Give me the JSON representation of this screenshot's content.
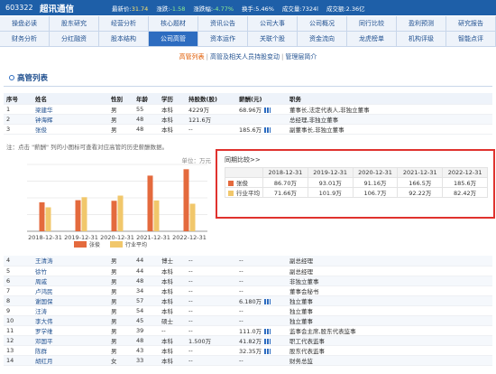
{
  "header": {
    "code": "603322",
    "name": "超讯通信",
    "quotes": [
      {
        "label": "最新价:",
        "value": "31.74",
        "cls": "up"
      },
      {
        "label": "涨跌:",
        "value": "-1.58",
        "cls": "dn"
      },
      {
        "label": "涨跌幅:",
        "value": "-4.77%",
        "cls": "dn"
      },
      {
        "label": "换手:",
        "value": "5.46%",
        "cls": ""
      },
      {
        "label": "成交量:",
        "value": "7324l",
        "cls": ""
      },
      {
        "label": "成交额:",
        "value": "2.36亿",
        "cls": ""
      }
    ]
  },
  "nav": {
    "row1": [
      "操盘必读",
      "股东研究",
      "经营分析",
      "核心题材",
      "资讯公告",
      "公司大事",
      "公司概况",
      "同行比较",
      "盈利预测",
      "研究报告"
    ],
    "row2": [
      "财务分析",
      "分红融资",
      "股本结构",
      "公司高管",
      "资本运作",
      "关联个股",
      "资金流向",
      "龙虎榜单",
      "机构评级",
      "智能点评"
    ],
    "active": "公司高管"
  },
  "sublinks": {
    "items": [
      "高管列表",
      "高管及相关人员持股变动",
      "管理层简介"
    ],
    "separator": "|"
  },
  "section_title": "高管列表",
  "table": {
    "headers": [
      "序号",
      "姓名",
      "性别",
      "年龄",
      "学历",
      "持股数(股)",
      "薪酬(元)",
      "职务"
    ],
    "top_rows": [
      [
        "1",
        "梁建华",
        "男",
        "55",
        "本科",
        "4229万",
        "68.96万",
        "董事长,法定代表人,非独立董事"
      ],
      [
        "2",
        "钟海辉",
        "男",
        "48",
        "本科",
        "121.6万",
        "",
        "总经理,非独立董事"
      ],
      [
        "3",
        "张俊",
        "男",
        "48",
        "本科",
        "--",
        "185.6万",
        "副董事长,非独立董事"
      ]
    ],
    "bottom_rows": [
      [
        "4",
        "王清涛",
        "男",
        "44",
        "博士",
        "--",
        "--",
        "副总经理"
      ],
      [
        "5",
        "徐竹",
        "男",
        "44",
        "本科",
        "--",
        "--",
        "副总经理"
      ],
      [
        "6",
        "周戚",
        "男",
        "48",
        "本科",
        "--",
        "--",
        "非独立董事"
      ],
      [
        "7",
        "卢鸿民",
        "男",
        "34",
        "本科",
        "--",
        "--",
        "董事会秘书"
      ],
      [
        "8",
        "谢国保",
        "男",
        "57",
        "本科",
        "--",
        "6.180万",
        "独立董事"
      ],
      [
        "9",
        "汪涛",
        "男",
        "54",
        "本科",
        "--",
        "--",
        "独立董事"
      ],
      [
        "10",
        "李大伟",
        "男",
        "45",
        "硕士",
        "--",
        "--",
        "独立董事"
      ],
      [
        "11",
        "罗学维",
        "男",
        "39",
        "--",
        "--",
        "111.0万",
        "监事会主席,股东代表监事"
      ],
      [
        "12",
        "邓国平",
        "男",
        "48",
        "本科",
        "1.500万",
        "41.82万",
        "职工代表监事"
      ],
      [
        "13",
        "陈群",
        "男",
        "43",
        "本科",
        "--",
        "32.35万",
        "股东代表监事"
      ],
      [
        "14",
        "胡红月",
        "女",
        "33",
        "本科",
        "--",
        "--",
        "财务总监"
      ]
    ]
  },
  "note": "注：点击 \"薪酬\" 列的小图标可查看对应高管的历史薪酬数据。",
  "chart_data": {
    "type": "bar",
    "unit_label": "单位：万元",
    "categories": [
      "2018-12-31",
      "2019-12-31",
      "2020-12-31",
      "2021-12-31",
      "2022-12-31"
    ],
    "series": [
      {
        "name": "张俊",
        "values": [
          86.7,
          93.01,
          91.16,
          166.5,
          185.6
        ],
        "color": "#e46a3d"
      },
      {
        "name": "行业平均",
        "values": [
          71.66,
          101.9,
          106.7,
          92.22,
          82.42
        ],
        "color": "#f1c76b"
      }
    ],
    "ylim": [
      0,
      200
    ]
  },
  "popup": {
    "title": "同期比较>>",
    "columns": [
      "2018-12-31",
      "2019-12-31",
      "2020-12-31",
      "2021-12-31",
      "2022-12-31"
    ],
    "rows": [
      {
        "label": "张俊",
        "color": "#e46a3d",
        "values": [
          "86.70万",
          "93.01万",
          "91.16万",
          "166.5万",
          "185.6万"
        ]
      },
      {
        "label": "行业平均",
        "color": "#f1c76b",
        "values": [
          "71.66万",
          "101.9万",
          "106.7万",
          "92.22万",
          "82.42万"
        ]
      }
    ]
  }
}
